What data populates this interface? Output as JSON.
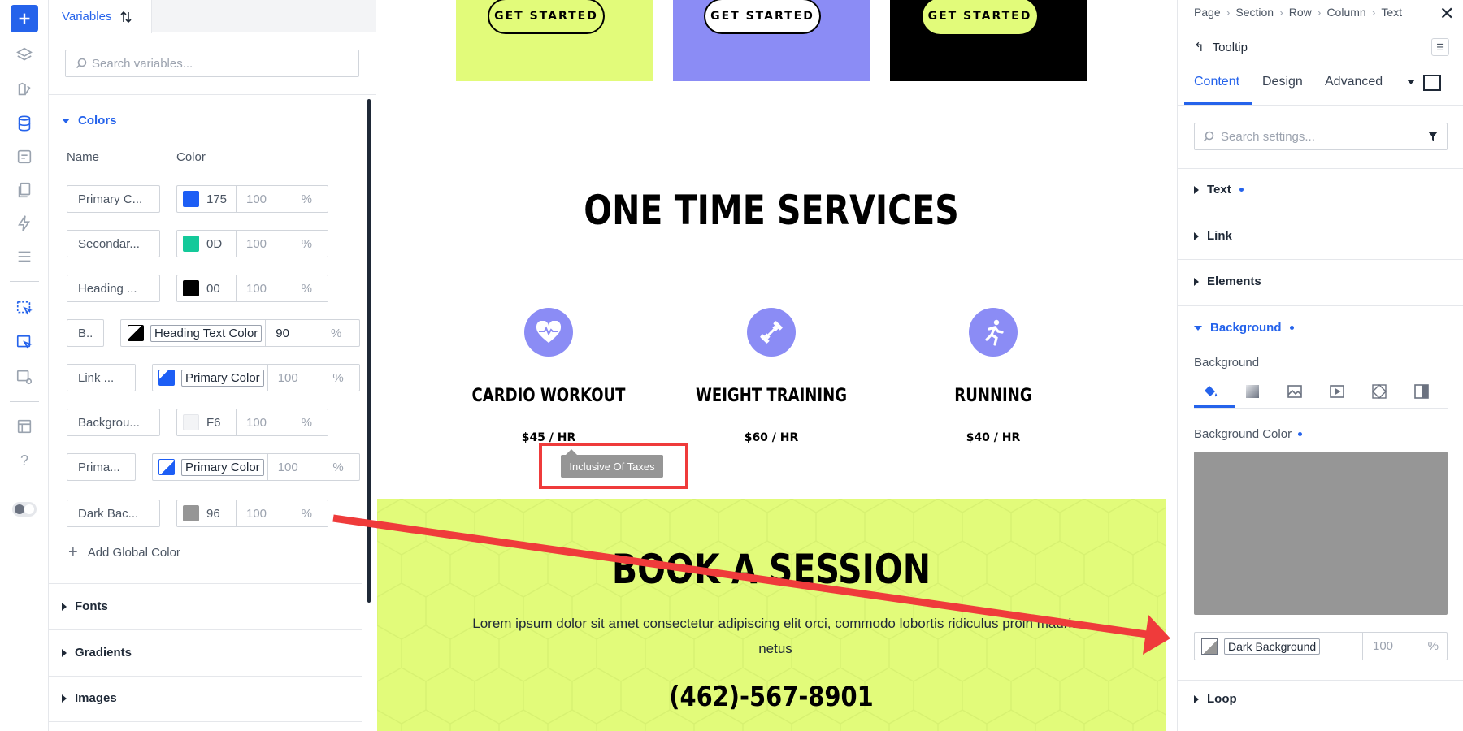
{
  "variables_panel": {
    "tab_label": "Variables",
    "search_placeholder": "Search variables...",
    "colors_section": "Colors",
    "col_name": "Name",
    "col_color": "Color",
    "rows": [
      {
        "name": "Primary C...",
        "hex": "175",
        "swatch": "#1d5ef5",
        "opacity": "100",
        "unit": "%"
      },
      {
        "name": "Secondar...",
        "hex": "0D",
        "swatch": "#14c99a",
        "opacity": "100",
        "unit": "%"
      },
      {
        "name": "Heading ...",
        "hex": "00",
        "swatch": "#000000",
        "opacity": "100",
        "unit": "%"
      },
      {
        "name": "B..",
        "ref": "Heading Text Color",
        "opacity": "90",
        "unit": "%"
      },
      {
        "name": "Link ...",
        "ref": "Primary Color",
        "opacity": "100",
        "unit": "%"
      },
      {
        "name": "Backgrou...",
        "hex": "F6",
        "swatch": "#f3f4f6",
        "opacity": "100",
        "unit": "%"
      },
      {
        "name": "Prima...",
        "ref": "Primary Color",
        "opacity": "100",
        "unit": "%"
      },
      {
        "name": "Dark Bac...",
        "hex": "96",
        "swatch": "#969696",
        "opacity": "100",
        "unit": "%"
      }
    ],
    "add_global_color": "Add Global Color",
    "fonts_section": "Fonts",
    "gradients_section": "Gradients",
    "images_section": "Images"
  },
  "canvas": {
    "get_started": "GET STARTED",
    "heading": "ONE TIME SERVICES",
    "services": [
      {
        "title": "CARDIO WORKOUT",
        "price": "$45 / HR",
        "icon": "heart-pulse-icon"
      },
      {
        "title": "WEIGHT TRAINING",
        "price": "$60 / HR",
        "icon": "dumbbell-icon"
      },
      {
        "title": "RUNNING",
        "price": "$40 / HR",
        "icon": "runner-icon"
      }
    ],
    "tooltip": "Inclusive Of Taxes",
    "book_heading": "BOOK A SESSION",
    "book_text": "Lorem ipsum dolor sit amet consectetur adipiscing elit orci, commodo lobortis ridiculus proin mauris netus",
    "phone": "(462)-567-8901",
    "colors": {
      "lime": "#e2fb7a",
      "lavender": "#8b8cf5",
      "black": "#000000",
      "annotation": "#ef3b3b"
    }
  },
  "settings_panel": {
    "breadcrumb": [
      "Page",
      "Section",
      "Row",
      "Column",
      "Text"
    ],
    "element_name": "Tooltip",
    "tabs": [
      "Content",
      "Design",
      "Advanced"
    ],
    "active_tab": "Content",
    "search_placeholder": "Search settings...",
    "sections": [
      "Text",
      "Link",
      "Elements",
      "Background",
      "Loop"
    ],
    "bg_label": "Background",
    "bg_color_label": "Background Color",
    "bg_color_value": "Dark Background",
    "bg_opacity": "100",
    "bg_unit": "%",
    "bg_preview": "#969696"
  }
}
